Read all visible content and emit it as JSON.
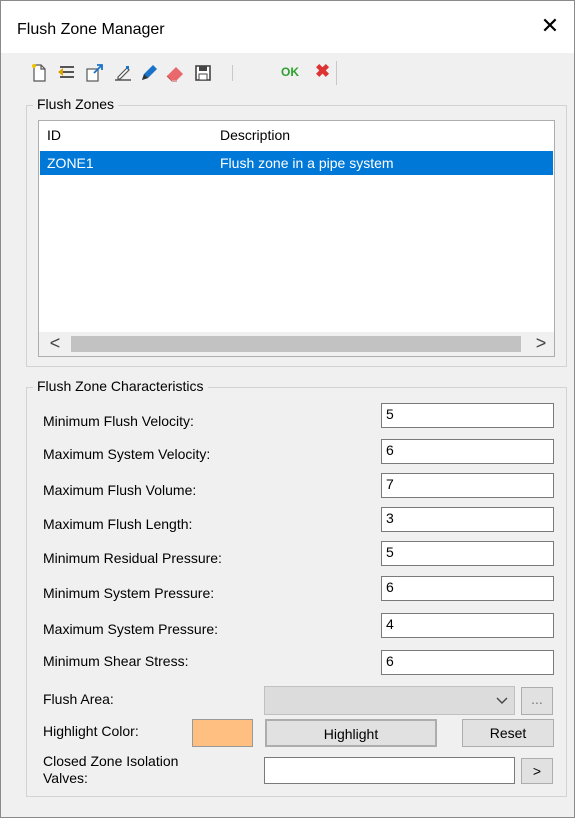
{
  "window": {
    "title": "Flush Zone Manager",
    "close_glyph": "✕"
  },
  "toolbar": {
    "icons": [
      "new-icon",
      "import-icon",
      "export-icon",
      "edit-icon",
      "pencil-icon",
      "eraser-icon",
      "save-icon"
    ],
    "ok_label": "OK",
    "cancel_glyph": "✖"
  },
  "zones_group": {
    "title": "Flush Zones",
    "columns": [
      "ID",
      "Description"
    ],
    "rows": [
      {
        "id": "ZONE1",
        "description": "Flush zone in a pipe system"
      }
    ],
    "scroll_left": "<",
    "scroll_right": ">"
  },
  "characteristics": {
    "title": "Flush Zone Characteristics",
    "fields": [
      {
        "label": "Minimum Flush Velocity:",
        "value": "5"
      },
      {
        "label": "Maximum System Velocity:",
        "value": "6"
      },
      {
        "label": "Maximum Flush Volume:",
        "value": "7"
      },
      {
        "label": "Maximum Flush Length:",
        "value": "3"
      },
      {
        "label": "Minimum Residual Pressure:",
        "value": "5"
      },
      {
        "label": "Minimum System Pressure:",
        "value": "6"
      },
      {
        "label": "Maximum System Pressure:",
        "value": "4"
      },
      {
        "label": "Minimum Shear Stress:",
        "value": "6"
      }
    ],
    "flush_area_label": "Flush Area:",
    "flush_area_value": "",
    "browse_label": "...",
    "highlight_color_label": "Highlight Color:",
    "highlight_color": "#ffbf80",
    "highlight_button": "Highlight",
    "reset_button": "Reset",
    "closed_valves_label_1": "Closed Zone Isolation",
    "closed_valves_label_2": "Valves:",
    "closed_valves_value": "",
    "go_button": ">"
  },
  "colors": {
    "selection": "#0078d7",
    "ok": "#2fa12f",
    "cancel": "#d33333"
  }
}
